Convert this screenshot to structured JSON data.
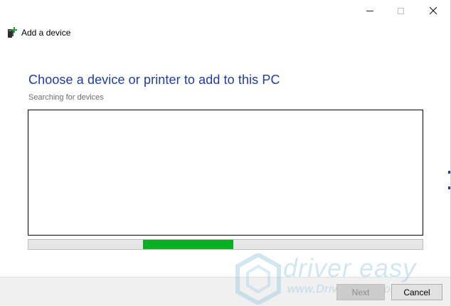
{
  "window": {
    "controls": {
      "minimize": "minimize-icon",
      "maximize": "maximize-icon",
      "close": "close-icon"
    }
  },
  "header": {
    "title": "Add a device",
    "icon": "add-device-icon"
  },
  "main": {
    "heading": "Choose a device or printer to add to this PC",
    "status": "Searching for devices",
    "heading_color": "#1f3d99"
  },
  "device_list": {
    "items": []
  },
  "progress": {
    "indeterminate": true,
    "segment_start": 0.29,
    "segment_length": 0.23,
    "color": "#06b025"
  },
  "footer": {
    "next_label": "Next",
    "cancel_label": "Cancel"
  },
  "watermark": {
    "brand": "driver easy",
    "url": "www.DriverEasy.com"
  }
}
